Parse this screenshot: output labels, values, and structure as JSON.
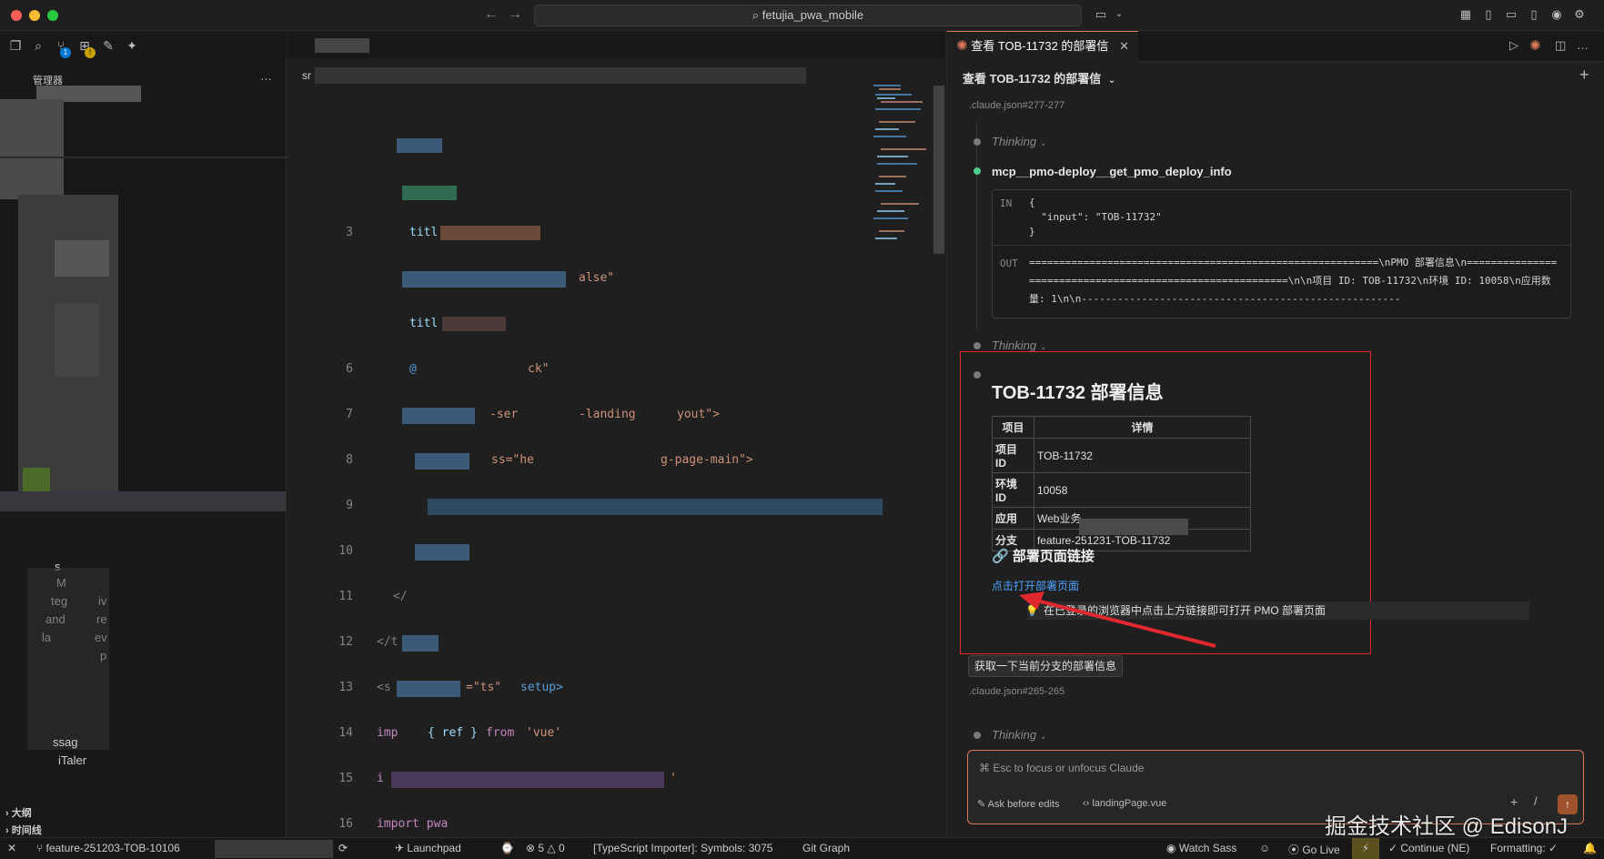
{
  "window": {
    "title": "fetujia_pwa_mobile"
  },
  "sidebar": {
    "title": "管理器",
    "outline_label": "大纲",
    "timeline_label": "时间线",
    "badges": {
      "source_control": "1"
    },
    "visible_fragments": [
      "s",
      "M",
      "teg",
      "iv",
      "and",
      "re",
      "la",
      "ev",
      "p",
      "ssag",
      "iTaler"
    ]
  },
  "editor": {
    "tab_fragment": "sr",
    "lines": [
      {
        "n": "3",
        "text": "titl"
      },
      {
        "n": "",
        "text": "alse\""
      },
      {
        "n": "",
        "text": "titl"
      },
      {
        "n": "6",
        "text": "@",
        "extra": "ck\""
      },
      {
        "n": "7",
        "text": "-ser",
        "extra": "-landing",
        "extra2": "yout\">"
      },
      {
        "n": "8",
        "text": "ss=\"he",
        "extra": "g-page-main\">"
      },
      {
        "n": "9",
        "text": ""
      },
      {
        "n": "10",
        "text": ""
      },
      {
        "n": "11",
        "text": "</"
      },
      {
        "n": "12",
        "text": "</t"
      },
      {
        "n": "13",
        "text": "<s",
        "lang": "=\"ts\"",
        "setup": "setup>"
      },
      {
        "n": "14",
        "text": "imp",
        "brace": "{ ref }",
        "from": "from",
        "module": "'vue'"
      },
      {
        "n": "15",
        "text": "i",
        "extra": "'"
      },
      {
        "n": "16",
        "text": "import pwa"
      }
    ]
  },
  "claude": {
    "tab_title": "查看 TOB-11732 的部署信",
    "header_title": "查看 TOB-11732 的部署信",
    "refs": [
      ".claude.json#277-277",
      ".claude.json#265-265"
    ],
    "thinking_label": "Thinking",
    "tool": {
      "name": "mcp__pmo-deploy__get_pmo_deploy_info",
      "in_label": "IN",
      "in_code": "{\n  \"input\": \"TOB-11732\"\n}",
      "out_label": "OUT",
      "out_text": "==========================================================\\nPMO 部署信息\\n==========================================================\\n\\n项目 ID: TOB-11732\\n环境 ID: 10058\\n应用数量: 1\\n\\n-----------------------------------------------------"
    },
    "response": {
      "title": "TOB-11732 部署信息",
      "table_headers": [
        "项目",
        "详情"
      ],
      "table_rows": [
        [
          "项目 ID",
          "TOB-11732"
        ],
        [
          "环境 ID",
          "10058"
        ],
        [
          "应用",
          "Web业务"
        ],
        [
          "分支",
          "feature-251231-TOB-11732"
        ]
      ],
      "link_heading": "🔗 部署页面链接",
      "link_text": "点击打开部署页面",
      "tip_text": "在已登录的浏览器中点击上方链接即可打开 PMO 部署页面"
    },
    "user_message": "获取一下当前分支的部署信息",
    "input": {
      "placeholder": "⌘ Esc to focus or unfocus Claude",
      "mode": "Ask before edits",
      "file": "landingPage.vue"
    }
  },
  "statusbar": {
    "branch": "feature-251203-TOB-10106",
    "launchpad": "Launchpad",
    "errors": "5",
    "warnings": "0",
    "ts_importer": "[TypeScript Importer]: Symbols: 3075",
    "git_graph": "Git Graph",
    "watch_sass": "Watch Sass",
    "go_live": "Go Live",
    "continue": "Continue (NE)",
    "formatting": "Formatting: ✓"
  },
  "watermark": "掘金技术社区 @ EdisonJ",
  "colors": {
    "accent": "#d97757",
    "link": "#4da3ff",
    "highlight_border": "#e0282e",
    "green_dot": "#4ec98b"
  }
}
